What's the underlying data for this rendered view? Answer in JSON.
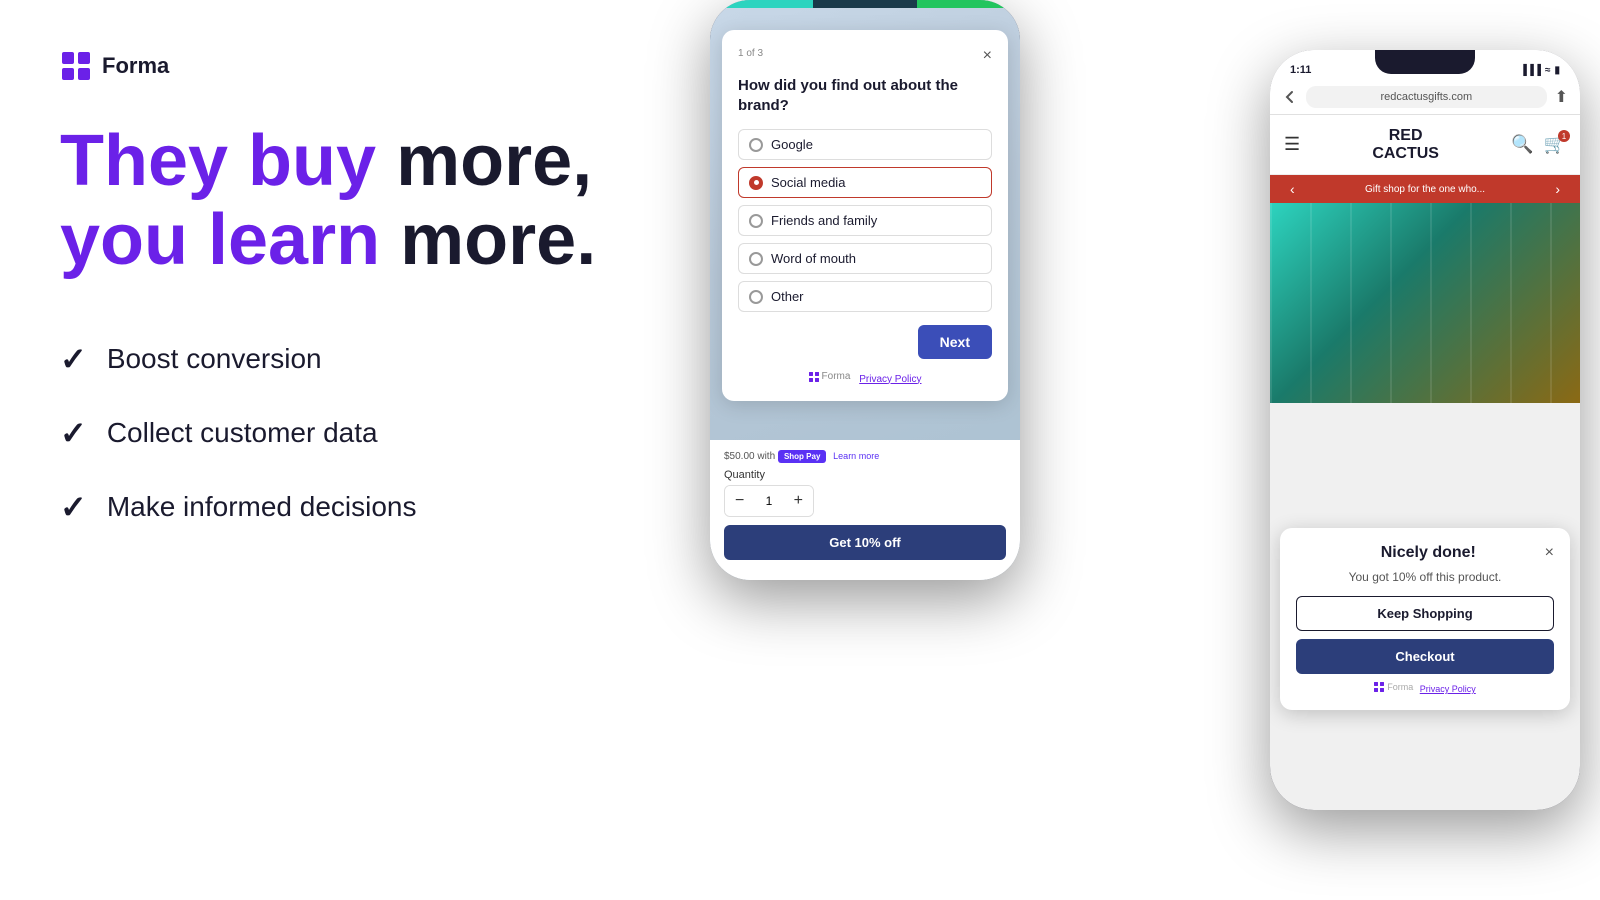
{
  "logo": {
    "text": "Forma"
  },
  "headline": {
    "line1_purple": "They buy",
    "line1_dark": "more,",
    "line2_purple": "you learn",
    "line2_dark": "more."
  },
  "features": [
    {
      "text": "Boost conversion"
    },
    {
      "text": "Collect customer data"
    },
    {
      "text": "Make informed decisions"
    }
  ],
  "phone_left": {
    "step_indicator": "1 of 3",
    "close_label": "×",
    "question": "How did you find out about the brand?",
    "options": [
      {
        "label": "Google",
        "selected": false
      },
      {
        "label": "Social media",
        "selected": true
      },
      {
        "label": "Friends and family",
        "selected": false
      },
      {
        "label": "Word of mouth",
        "selected": false
      },
      {
        "label": "Other",
        "selected": false
      }
    ],
    "next_button": "Next",
    "footer_powered": "Forma",
    "footer_policy": "Privacy Policy",
    "shop_pay_text": "$50.00 with",
    "shop_pay_badge": "Shop Pay",
    "shop_pay_suffix": "Learn more",
    "quantity_label": "Quantity",
    "quantity_value": "1",
    "qty_minus": "−",
    "qty_plus": "+",
    "discount_button": "Get 10% off"
  },
  "phone_right": {
    "status_time": "1:11",
    "browser_url": "redcactusgifts.com",
    "store_name_line1": "RED",
    "store_name_line2": "CACTUS",
    "promo_text": "Gift shop for the one who...",
    "success_popup": {
      "title": "Nicely done!",
      "description": "You got 10% off this product.",
      "keep_shopping": "Keep Shopping",
      "checkout": "Checkout",
      "footer": "Forma  Privacy Policy"
    }
  }
}
